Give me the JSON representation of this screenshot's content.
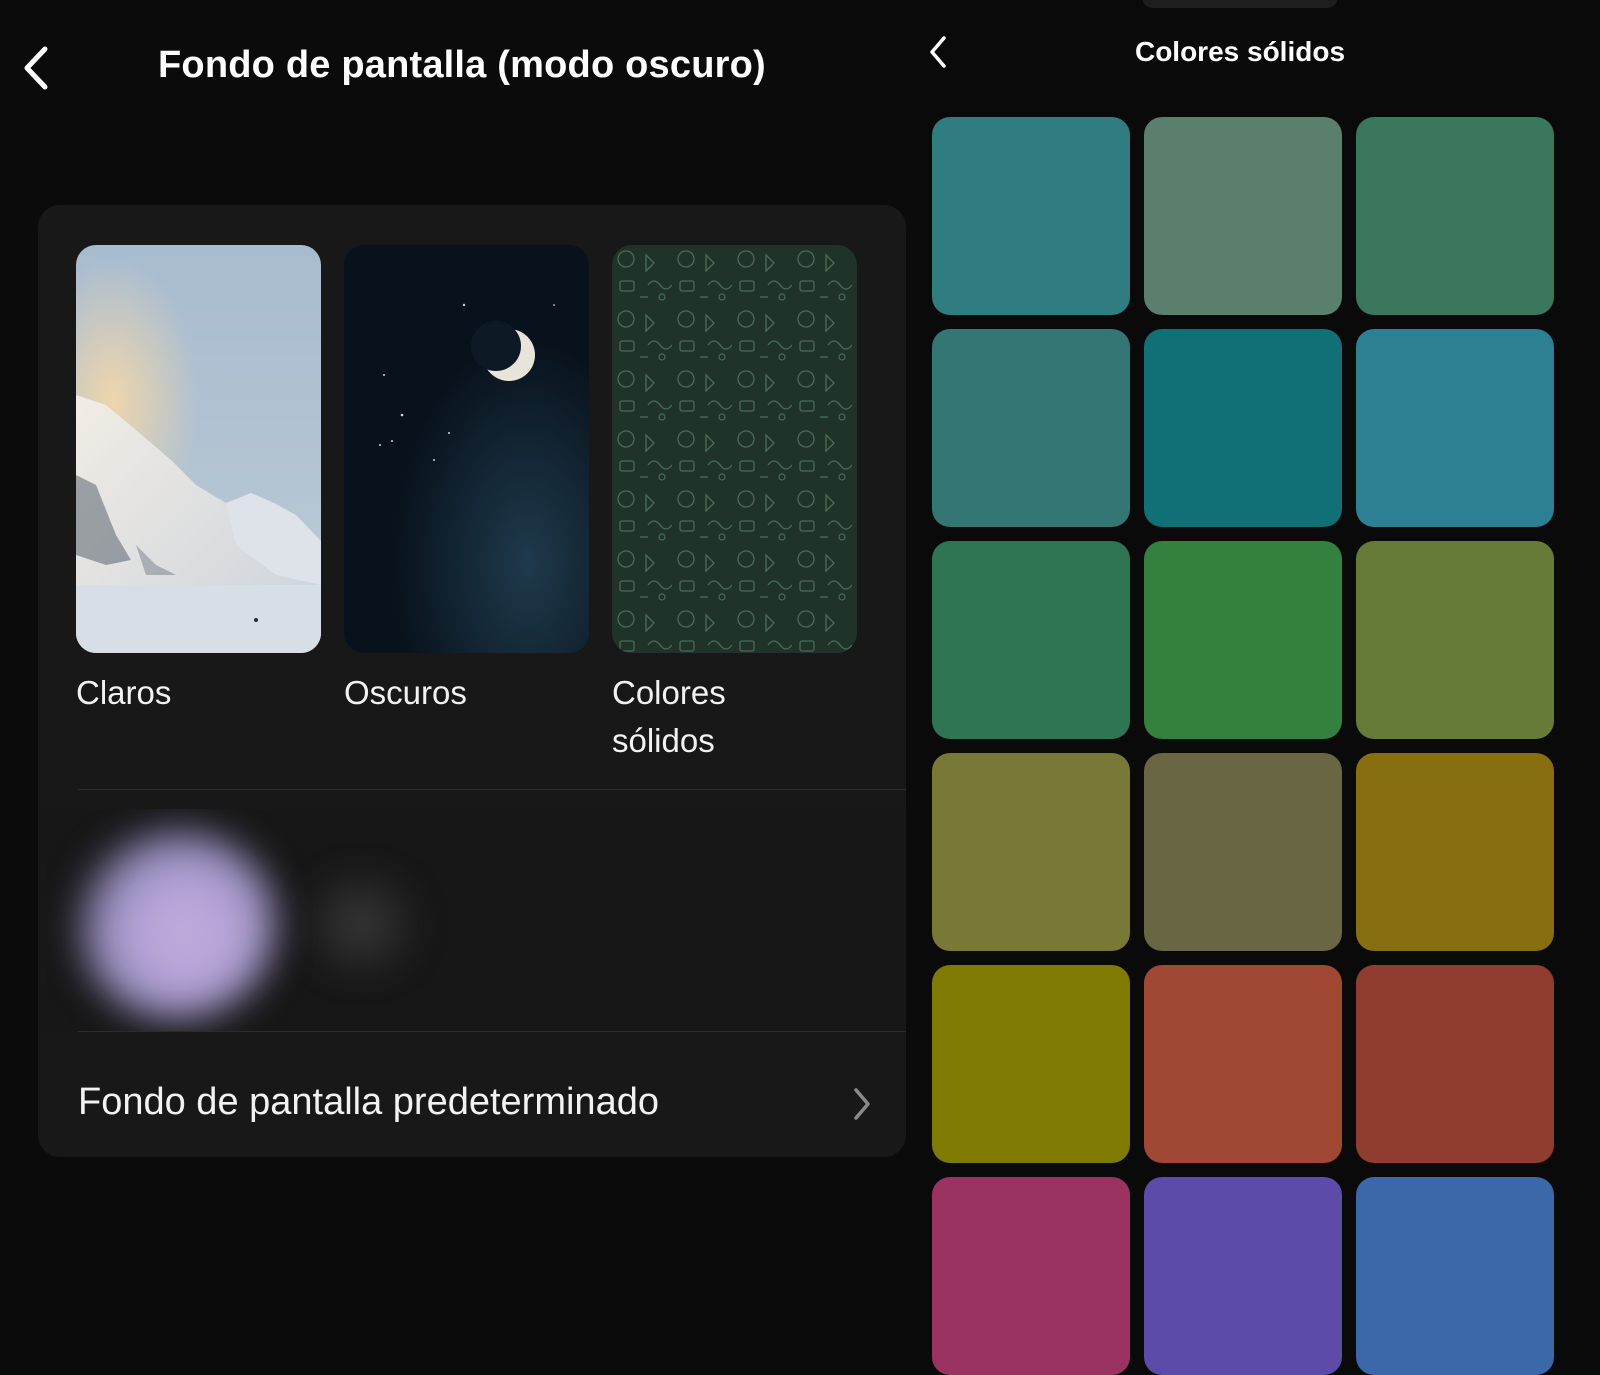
{
  "left": {
    "title": "Fondo de pantalla (modo oscuro)",
    "categories": [
      {
        "label": "Claros"
      },
      {
        "label": "Oscuros"
      },
      {
        "label": "Colores sólidos"
      }
    ],
    "default_row_label": "Fondo de pantalla predeterminado"
  },
  "right": {
    "title": "Colores sólidos",
    "swatches": [
      "#2f7d80",
      "#5a806d",
      "#3a775c",
      "#337673",
      "#117076",
      "#2d7f93",
      "#2f7553",
      "#34803f",
      "#667b37",
      "#787936",
      "#686643",
      "#876e10",
      "#7f7a02",
      "#a14834",
      "#913c30",
      "#9a3360",
      "#5e4aa8",
      "#3a68a8"
    ]
  },
  "icons": {
    "back": "chevron-left-icon",
    "forward": "chevron-right-icon"
  }
}
